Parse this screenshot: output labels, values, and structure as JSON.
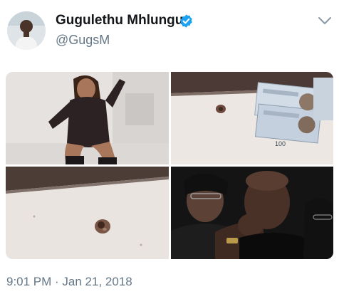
{
  "tweet": {
    "display_name": "Gugulethu Mhlungu",
    "handle": "@GugsM",
    "timestamp": "9:01 PM · Jan 21, 2018"
  },
  "header": {
    "avatar_icon": "profile-avatar",
    "verified_icon": "verified-badge-icon",
    "verified_color": "#1da1f2",
    "menu_icon": "chevron-down-icon"
  },
  "media": {
    "count": 4,
    "photos": [
      {
        "name": "photo-woman-posing"
      },
      {
        "name": "photo-wall-stain-banknotes",
        "banknote_text": "100"
      },
      {
        "name": "photo-wall-stain-closeup"
      },
      {
        "name": "photo-mourners"
      }
    ]
  },
  "colors": {
    "name_text": "#14171a",
    "secondary_text": "#657786",
    "background": "#ffffff"
  }
}
